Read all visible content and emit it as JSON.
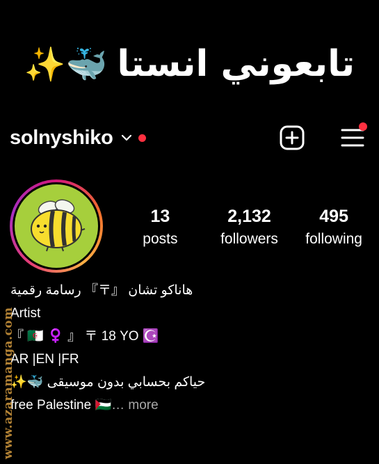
{
  "banner": {
    "text": "تابعوني انستا",
    "emoji": "✨🐳"
  },
  "profile": {
    "username": "solnyshiko",
    "posts_count": "13",
    "posts_label": "posts",
    "followers_count": "2,132",
    "followers_label": "followers",
    "following_count": "495",
    "following_label": "following"
  },
  "bio": {
    "name": "هاناكو تشان 『〒』 رسامة رقمية",
    "category": "Artist",
    "line1": "『 🇩🇿 ♀️ 』 〒 18 YO ☪️",
    "line2": "AR |EN |FR",
    "line3": "✨🐳 حياكم بحسابي بدون موسيقى",
    "line4": "free Palestine 🇵🇸",
    "more": "… more"
  },
  "watermark": "www.azaramanga.com",
  "colors": {
    "notification": "#ff3040",
    "avatar_bg": "#a6cf3c",
    "watermark": "#c5903a"
  },
  "icons": [
    "chevron-down-icon",
    "new-post-icon",
    "menu-icon"
  ]
}
